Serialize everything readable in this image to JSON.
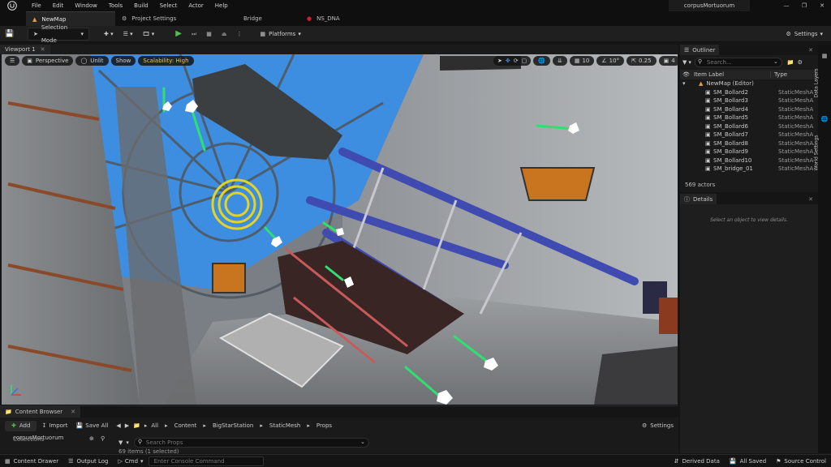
{
  "menu": [
    "File",
    "Edit",
    "Window",
    "Tools",
    "Build",
    "Select",
    "Actor",
    "Help"
  ],
  "project_name": "corpusMortuorum",
  "tabs": [
    {
      "label": "NewMap"
    },
    {
      "label": "Project Settings"
    },
    {
      "label": "Bridge"
    },
    {
      "label": "NS_DNA"
    }
  ],
  "toolbar": {
    "selection_mode": "Selection Mode",
    "platforms": "Platforms",
    "settings": "Settings"
  },
  "viewport": {
    "tab_label": "Viewport 1",
    "perspective": "Perspective",
    "unlit": "Unlit",
    "show": "Show",
    "scalability": "Scalability: High",
    "grid_snap": "10",
    "rot_snap": "10°",
    "scale_snap": "0.25",
    "camera_speed": "4"
  },
  "content_browser": {
    "tab_label": "Content Browser",
    "add": "Add",
    "import": "Import",
    "save_all": "Save All",
    "breadcrumb": [
      "All",
      "Content",
      "BigStarStation",
      "StaticMesh",
      "Props"
    ],
    "settings": "Settings",
    "tree_root": "corpusMortuorum",
    "collections": "Collections",
    "search_placeholder": "Search Props",
    "item_count": "69 items (1 selected)"
  },
  "outliner": {
    "title": "Outliner",
    "search_placeholder": "Search...",
    "col_label": "Item Label",
    "col_type": "Type",
    "root": "NewMap (Editor)",
    "items": [
      {
        "label": "SM_Bollard2",
        "type": "StaticMeshA"
      },
      {
        "label": "SM_Bollard3",
        "type": "StaticMeshA"
      },
      {
        "label": "SM_Bollard4",
        "type": "StaticMeshA"
      },
      {
        "label": "SM_Bollard5",
        "type": "StaticMeshA"
      },
      {
        "label": "SM_Bollard6",
        "type": "StaticMeshA"
      },
      {
        "label": "SM_Bollard7",
        "type": "StaticMeshA"
      },
      {
        "label": "SM_Bollard8",
        "type": "StaticMeshA"
      },
      {
        "label": "SM_Bollard9",
        "type": "StaticMeshA"
      },
      {
        "label": "SM_Bollard10",
        "type": "StaticMeshA"
      },
      {
        "label": "SM_bridge_01",
        "type": "StaticMeshA"
      }
    ],
    "actor_count": "569 actors"
  },
  "details": {
    "title": "Details",
    "empty_hint": "Select an object to view details."
  },
  "side_tabs": [
    "Data Layers",
    "World Settings"
  ],
  "statusbar": {
    "content_drawer": "Content Drawer",
    "output_log": "Output Log",
    "cmd": "Cmd",
    "console_placeholder": "Enter Console Command",
    "derived_data": "Derived Data",
    "all_saved": "All Saved",
    "source_control": "Source Control"
  },
  "colors": {
    "accent_green": "#4fbf4f",
    "warning_yellow": "#f2c74a",
    "sky_blue": "#3d8ee0",
    "gizmo_green": "#2fe070",
    "record_red": "#d02020"
  }
}
